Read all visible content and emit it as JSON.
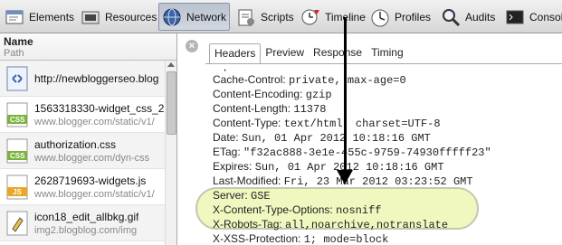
{
  "toolbar": {
    "items": [
      {
        "label": "Elements",
        "icon": "elements-icon"
      },
      {
        "label": "Resources",
        "icon": "resources-icon"
      },
      {
        "label": "Network",
        "icon": "network-icon",
        "active": true
      },
      {
        "label": "Scripts",
        "icon": "scripts-icon"
      },
      {
        "label": "Timeline",
        "icon": "timeline-icon"
      },
      {
        "label": "Profiles",
        "icon": "profiles-icon"
      },
      {
        "label": "Audits",
        "icon": "audits-icon"
      },
      {
        "label": "Console",
        "icon": "console-icon"
      }
    ]
  },
  "resources": {
    "header_name": "Name",
    "header_path": "Path",
    "items": [
      {
        "name": "http://newbloggerseo.blog",
        "path": "",
        "icon": "html-file-icon"
      },
      {
        "name": "1563318330-widget_css_2",
        "path": "www.blogger.com/static/v1/",
        "icon": "css-file-icon"
      },
      {
        "name": "authorization.css",
        "path": "www.blogger.com/dyn-css",
        "icon": "css-file-icon"
      },
      {
        "name": "2628719693-widgets.js",
        "path": "www.blogger.com/static/v1/",
        "icon": "js-file-icon"
      },
      {
        "name": "icon18_edit_allbkg.gif",
        "path": "img2.blogblog.com/img",
        "icon": "image-file-icon"
      }
    ]
  },
  "detail": {
    "close_label": "×",
    "tabs": [
      "Headers",
      "Preview",
      "Response",
      "Timing"
    ],
    "active_tab": "Headers",
    "partial_top": "·",
    "headers": [
      {
        "key": "Cache-Control",
        "value": "private, max-age=0"
      },
      {
        "key": "Content-Encoding",
        "value": "gzip"
      },
      {
        "key": "Content-Length",
        "value": "11378"
      },
      {
        "key": "Content-Type",
        "value": "text/html; charset=UTF-8"
      },
      {
        "key": "Date",
        "value": "Sun, 01 Apr 2012 10:18:16 GMT"
      },
      {
        "key": "ETag",
        "value": "\"f32ac888-3e1e-455c-9759-74930fffff23\""
      },
      {
        "key": "Expires",
        "value": "Sun, 01 Apr 2012 10:18:16 GMT"
      },
      {
        "key": "Last-Modified",
        "value": "Fri, 23 Mar 2012 03:23:52 GMT"
      },
      {
        "key": "Server",
        "value": "GSE"
      },
      {
        "key": "X-Content-Type-Options",
        "value": "nosniff"
      },
      {
        "key": "X-Robots-Tag",
        "value": "all,noarchive,notranslate"
      },
      {
        "key": "X-XSS-Protection",
        "value": "1; mode=block"
      }
    ]
  },
  "colors": {
    "highlight": "#ebf5aa",
    "active_tool": "#c3cbd6"
  }
}
